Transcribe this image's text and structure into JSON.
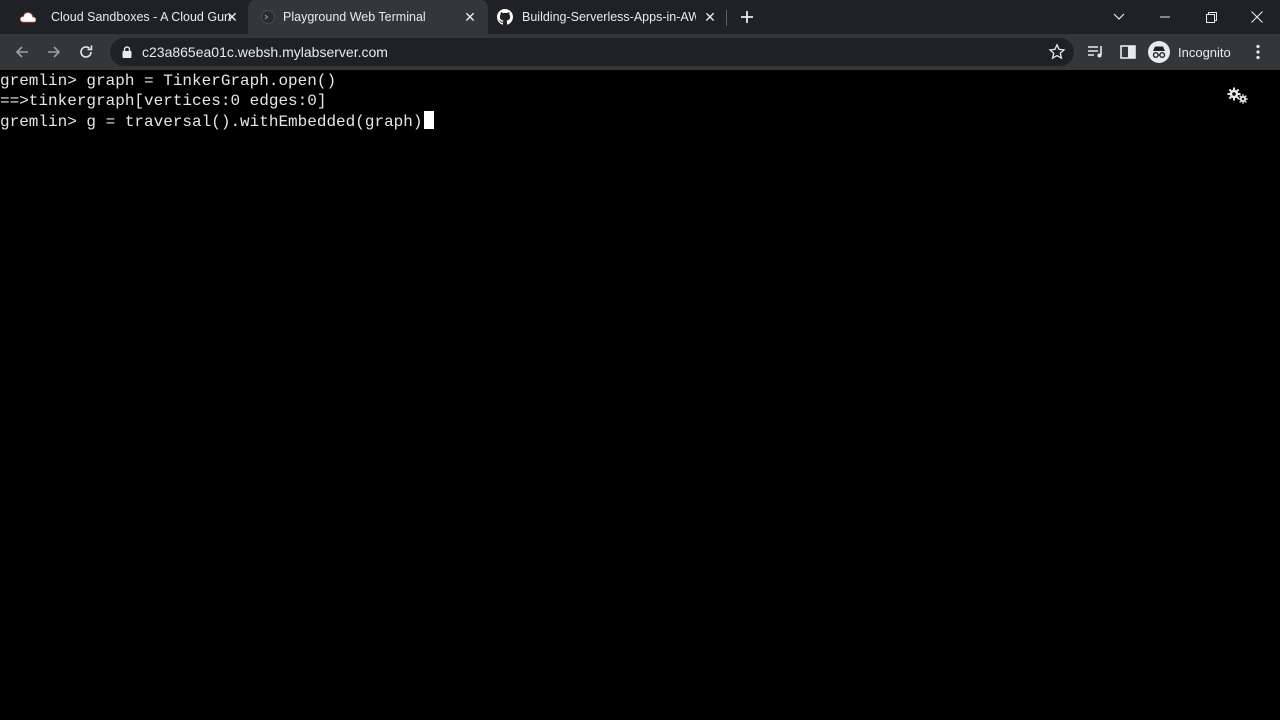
{
  "tabs": [
    {
      "title": "Cloud Sandboxes - A Cloud Guru",
      "icon": "acloudguru-cloud-icon",
      "active": false
    },
    {
      "title": "Playground Web Terminal",
      "icon": "terminal-favicon-icon",
      "active": true
    },
    {
      "title": "Building-Serverless-Apps-in-AWS",
      "icon": "github-icon",
      "active": false
    }
  ],
  "toolbar": {
    "url": "c23a865ea01c.websh.mylabserver.com",
    "profile_label": "Incognito"
  },
  "terminal": {
    "lines": [
      "gremlin> graph = TinkerGraph.open()",
      "==>tinkergraph[vertices:0 edges:0]",
      "gremlin> g = traversal().withEmbedded(graph)"
    ]
  },
  "colors": {
    "tabbar_bg": "#202124",
    "toolbar_bg": "#35363a",
    "terminal_bg": "#000000",
    "terminal_fg": "#e6e6e6",
    "acg_accent": "#f1736a"
  }
}
